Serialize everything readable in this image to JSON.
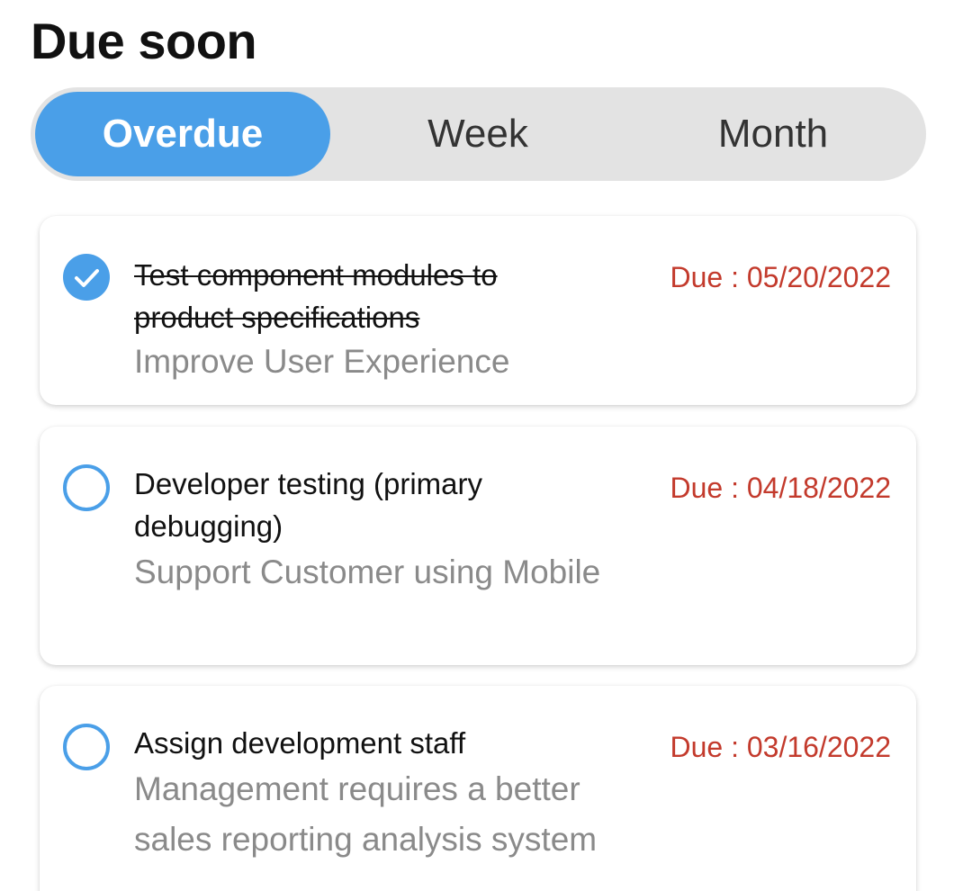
{
  "header": {
    "title": "Due soon"
  },
  "filter": {
    "tabs": [
      {
        "label": "Overdue",
        "active": true
      },
      {
        "label": "Week",
        "active": false
      },
      {
        "label": "Month",
        "active": false
      }
    ]
  },
  "tasks": [
    {
      "title": "Test component modules to product specifications",
      "project": "Improve User Experience",
      "due": "Due : 05/20/2022",
      "completed": true
    },
    {
      "title": "Developer testing (primary debugging)",
      "project": "Support Customer using Mobile",
      "due": "Due : 04/18/2022",
      "completed": false
    },
    {
      "title": "Assign development staff",
      "project": "Management requires a better sales reporting analysis system",
      "due": "Due : 03/16/2022",
      "completed": false
    }
  ],
  "colors": {
    "accent": "#4a9fe8",
    "due": "#c33a2c",
    "secondary_text": "#8a8a8a",
    "segment_bg": "#e3e3e3"
  },
  "icons": {
    "completed": "check-circle-filled-icon",
    "open": "circle-outline-icon"
  }
}
